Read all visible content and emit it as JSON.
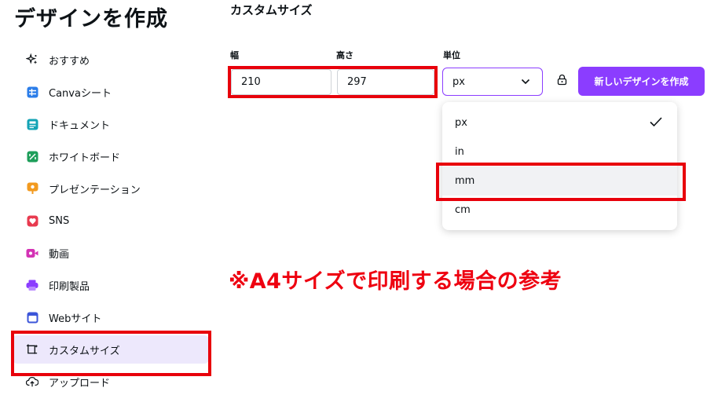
{
  "page_title": "デザインを作成",
  "sidebar": {
    "items": [
      {
        "label": "おすすめ",
        "icon": "sparkle-icon"
      },
      {
        "label": "Canvaシート",
        "icon": "sheet-icon",
        "color": "#2b7de9"
      },
      {
        "label": "ドキュメント",
        "icon": "document-icon",
        "color": "#13a3b5"
      },
      {
        "label": "ホワイトボード",
        "icon": "whiteboard-icon",
        "color": "#1e9e5a"
      },
      {
        "label": "プレゼンテーション",
        "icon": "presentation-icon",
        "color": "#f29a1f"
      },
      {
        "label": "SNS",
        "icon": "heart-icon",
        "color": "#e83a4f"
      },
      {
        "label": "動画",
        "icon": "video-icon",
        "color": "#d433b5"
      },
      {
        "label": "印刷製品",
        "icon": "printer-icon",
        "color": "#8b3dff"
      },
      {
        "label": "Webサイト",
        "icon": "browser-icon",
        "color": "#3b55d9"
      },
      {
        "label": "カスタムサイズ",
        "icon": "custom-size-icon",
        "active": true
      },
      {
        "label": "アップロード",
        "icon": "upload-icon"
      }
    ]
  },
  "custom_size": {
    "title": "カスタムサイズ",
    "width_label": "幅",
    "height_label": "高さ",
    "unit_label": "単位",
    "width_value": "210",
    "height_value": "297",
    "unit_value": "px",
    "create_button": "新しいデザインを作成"
  },
  "unit_dropdown": {
    "options": [
      "px",
      "in",
      "mm",
      "cm"
    ],
    "selected": "px",
    "highlighted": "mm"
  },
  "annotation": "※A4サイズで印刷する場合の参考",
  "colors": {
    "accent": "#8b3dff",
    "highlight_box": "#e8000b",
    "annotation_text": "#ee0010",
    "active_nav_bg": "#ede8fc"
  }
}
